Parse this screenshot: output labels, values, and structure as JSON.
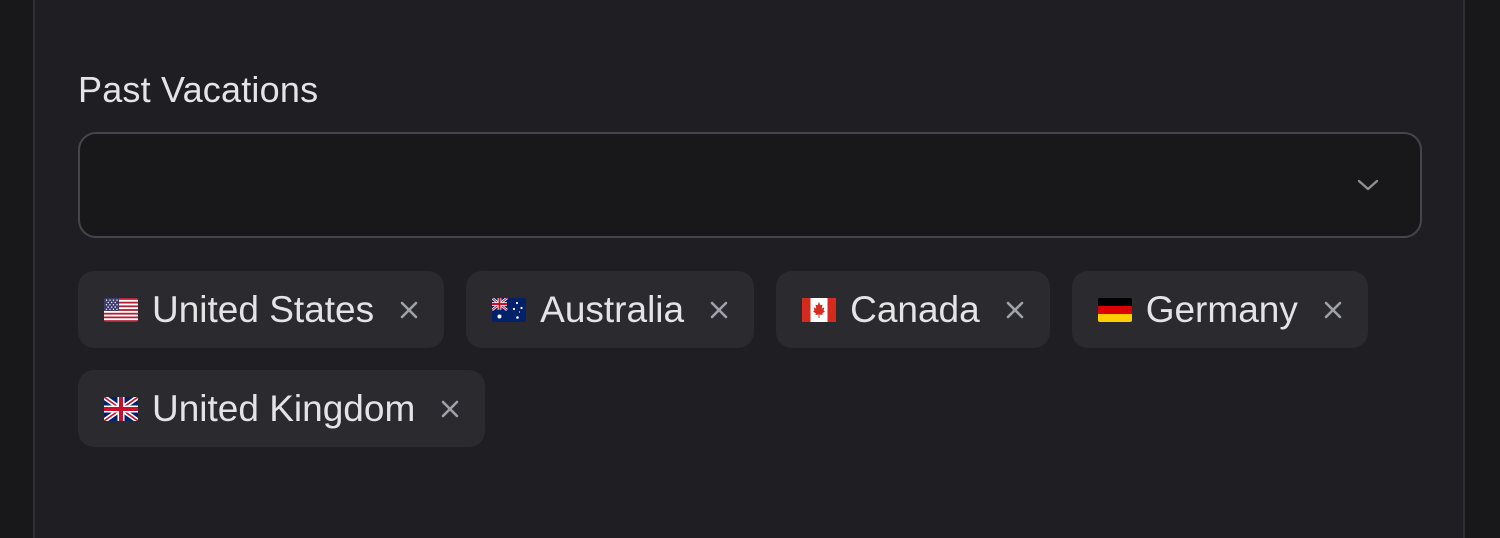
{
  "field": {
    "label": "Past Vacations",
    "select_value": ""
  },
  "icons": {
    "dropdown": "chevron-down-icon",
    "remove": "close-icon"
  },
  "colors": {
    "panel_bg": "#1f1f23",
    "tag_bg": "#2a2a2f",
    "text": "#e4e4e7",
    "muted": "#a1a1aa"
  },
  "tags": [
    {
      "label": "United States",
      "flag": "us-flag-icon"
    },
    {
      "label": "Australia",
      "flag": "au-flag-icon"
    },
    {
      "label": "Canada",
      "flag": "ca-flag-icon"
    },
    {
      "label": "Germany",
      "flag": "de-flag-icon"
    },
    {
      "label": "United Kingdom",
      "flag": "gb-flag-icon"
    }
  ]
}
